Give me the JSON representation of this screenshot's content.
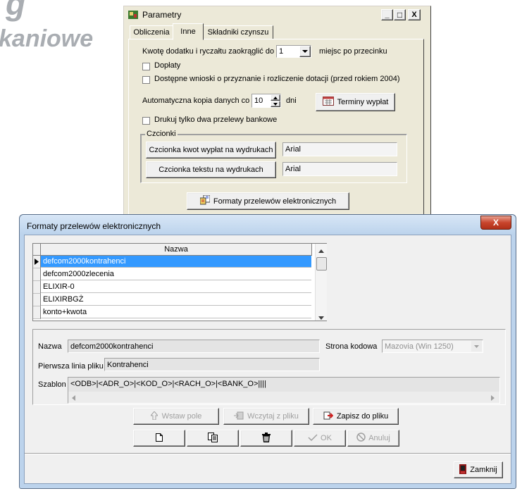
{
  "background": {
    "g_letter": "g",
    "word": "kaniowe"
  },
  "parametry": {
    "title": "Parametry",
    "win_buttons": {
      "minimize": "_",
      "maximize": "□",
      "close": "X"
    },
    "tabs": [
      {
        "label": "Obliczenia"
      },
      {
        "label": "Inne"
      },
      {
        "label": "Składniki czynszu"
      }
    ],
    "round_label": "Kwotę dodatku i ryczałtu zaokrąglić do",
    "round_value": "1",
    "round_suffix": "miejsc po przecinku",
    "checks": [
      {
        "label": "Dopłaty",
        "checked": false
      },
      {
        "label": "Dostępne wnioski o przyznanie i rozliczenie dotacji (przed rokiem 2004)",
        "checked": false
      }
    ],
    "backup_label": "Automatyczna kopia danych co",
    "backup_value": "10",
    "backup_suffix": "dni",
    "terminy_button": "Terminy wypłat",
    "print_check": {
      "label": "Drukuj tylko dwa przelewy bankowe",
      "checked": false
    },
    "fonts_group": "Czcionki",
    "font_amount_button": "Czcionka kwot wypłat na wydrukach",
    "font_amount_value": "Arial",
    "font_text_button": "Czcionka tekstu na wydrukach",
    "font_text_value": "Arial",
    "formats_button": "Formaty przelewów elektronicznych"
  },
  "formaty": {
    "title": "Formaty przelewów elektronicznych",
    "close": "X",
    "grid_header": "Nazwa",
    "rows": [
      {
        "name": "defcom2000kontrahenci",
        "selected": true
      },
      {
        "name": "defcom2000zlecenia",
        "selected": false
      },
      {
        "name": "ELIXIR-0",
        "selected": false
      },
      {
        "name": "ELIXIRBGŻ",
        "selected": false
      },
      {
        "name": "konto+kwota",
        "selected": false
      }
    ],
    "nazwa_label": "Nazwa",
    "nazwa_value": "defcom2000kontrahenci",
    "strona_label": "Strona kodowa",
    "strona_value": "Mazovia (Win 1250)",
    "pierwsza_label": "Pierwsza linia pliku",
    "pierwsza_value": "Kontrahenci",
    "szablon_label": "Szablon",
    "szablon_value": "<ODB>|<ADR_O>|<KOD_O>|<RACH_O>|<BANK_O>||||",
    "btn_wstaw": "Wstaw pole",
    "btn_wczytaj": "Wczytaj z pliku",
    "btn_zapisz": "Zapisz do pliku",
    "btn_ok": "OK",
    "btn_anuluj": "Anuluj",
    "btn_zamknij": "Zamknij"
  }
}
